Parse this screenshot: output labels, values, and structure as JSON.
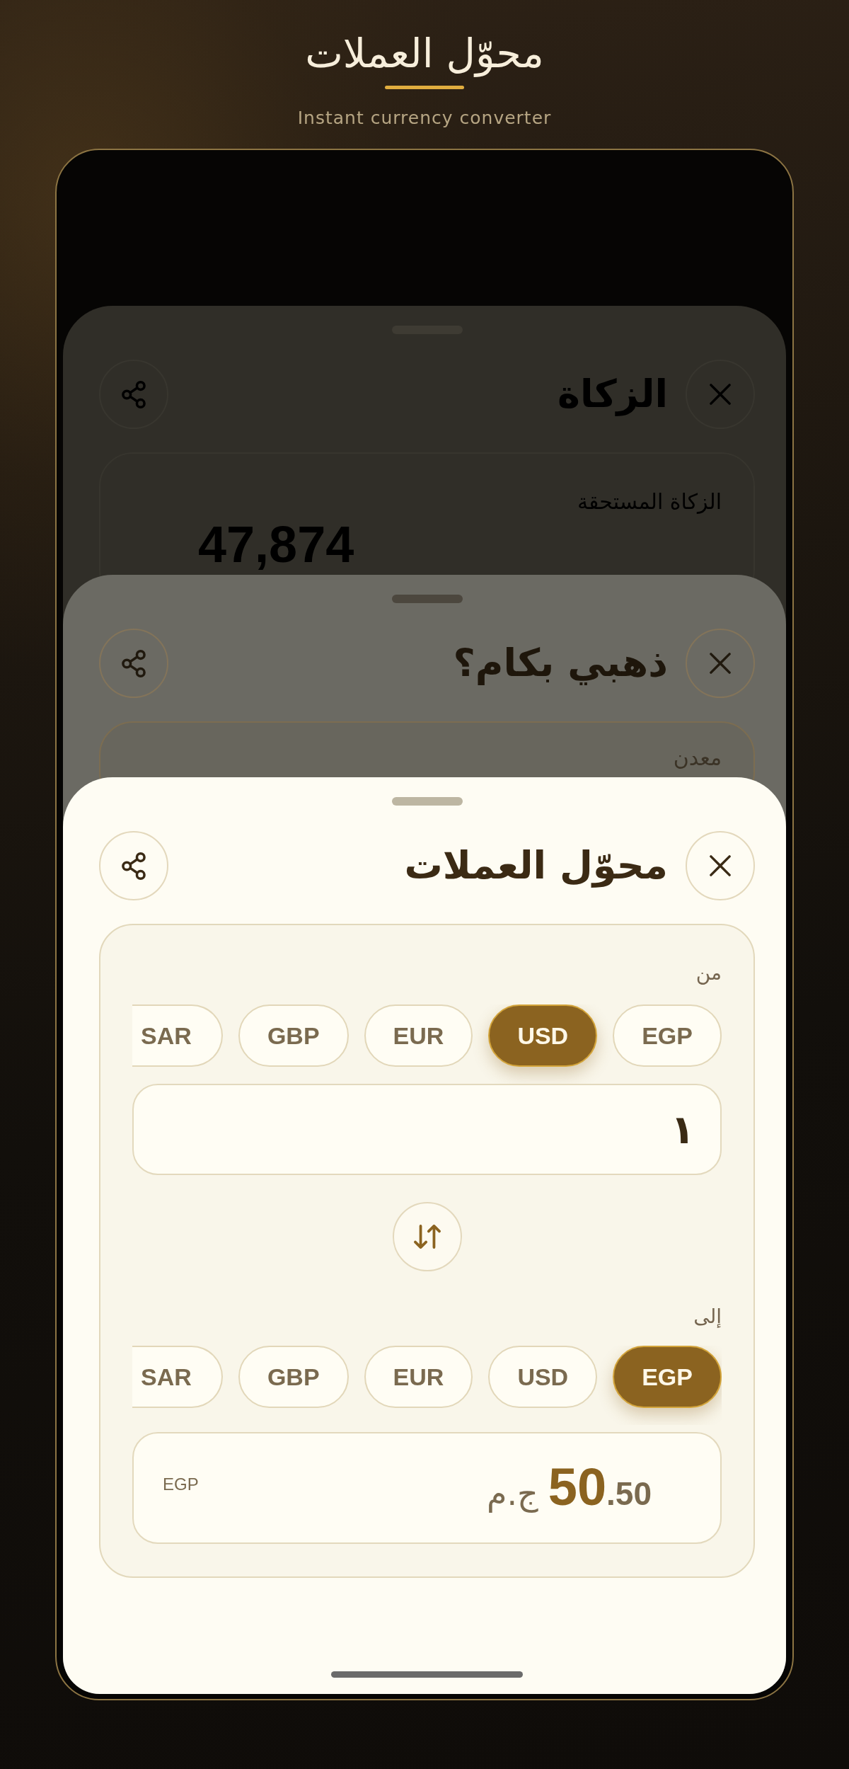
{
  "header": {
    "title": "محوّل العملات",
    "subtitle": "Instant currency converter"
  },
  "background_sheets": [
    {
      "title": "الزكاة",
      "card": {
        "label": "الزكاة المستحقة",
        "amount": "47,874"
      }
    },
    {
      "title": "ذهبي بكام؟",
      "card": {
        "label": "معدن"
      }
    }
  ],
  "sheet": {
    "title": "محوّل العملات",
    "from": {
      "label": "من",
      "currencies": [
        {
          "code": "EGP",
          "selected": false
        },
        {
          "code": "USD",
          "selected": true
        },
        {
          "code": "EUR",
          "selected": false
        },
        {
          "code": "GBP",
          "selected": false
        },
        {
          "code": "SAR",
          "selected": false
        }
      ]
    },
    "amount_input": {
      "value": "١"
    },
    "to": {
      "label": "إلى",
      "currencies": [
        {
          "code": "EGP",
          "selected": true
        },
        {
          "code": "USD",
          "selected": false
        },
        {
          "code": "EUR",
          "selected": false
        },
        {
          "code": "GBP",
          "selected": false
        },
        {
          "code": "SAR",
          "selected": false
        }
      ]
    },
    "result": {
      "code": "EGP",
      "amount_main": "50",
      "amount_fraction": ".50",
      "symbol": "ج.م"
    }
  }
}
